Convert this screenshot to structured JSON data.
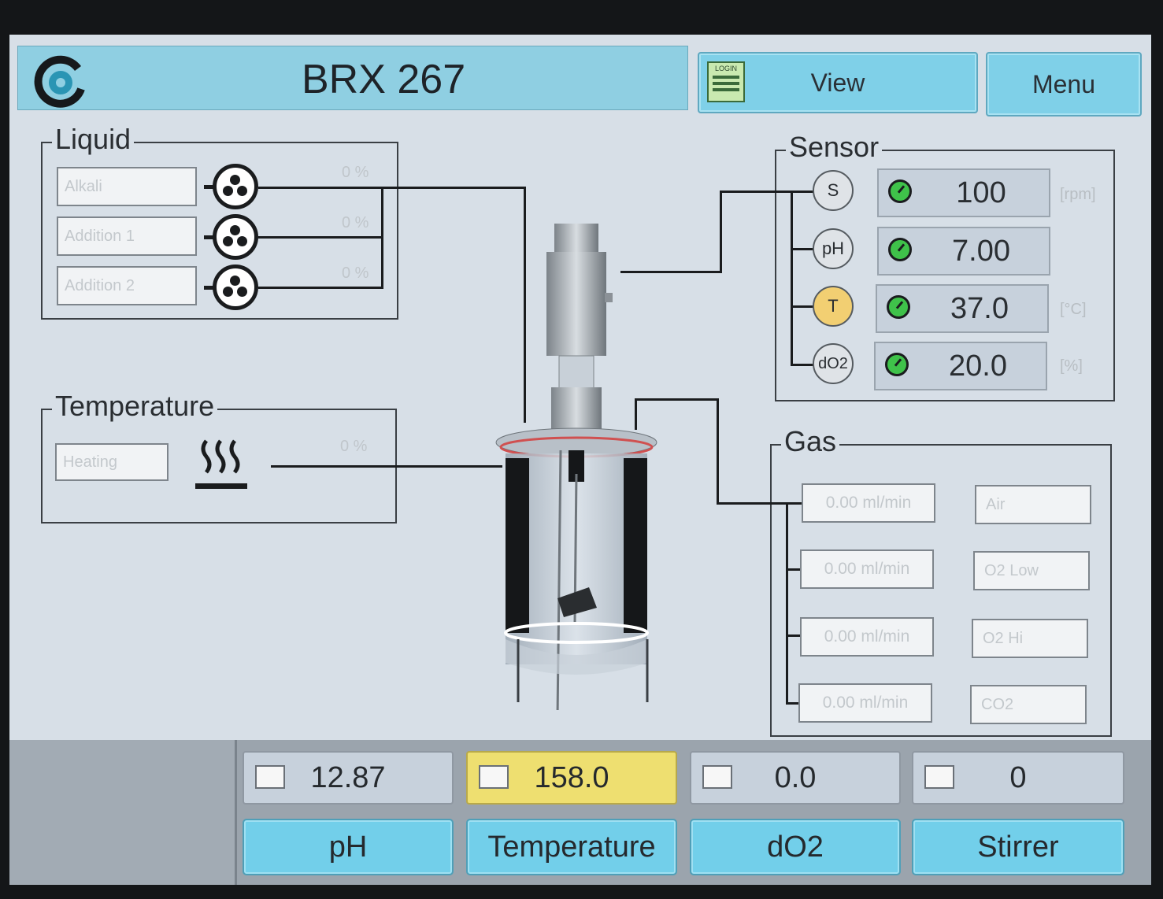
{
  "header": {
    "title": "BRX 267",
    "view_label": "View",
    "menu_label": "Menu",
    "login_icon_text": "LOGIN"
  },
  "liquid": {
    "label": "Liquid",
    "items": [
      {
        "name": "Alkali",
        "percent": "0 %"
      },
      {
        "name": "Addition 1",
        "percent": "0 %"
      },
      {
        "name": "Addition 2",
        "percent": "0 %"
      }
    ]
  },
  "temperature_panel": {
    "label": "Temperature",
    "mode": "Heating",
    "percent": "0 %"
  },
  "sensor": {
    "label": "Sensor",
    "rows": [
      {
        "symbol": "S",
        "value": "100",
        "unit": "[rpm]"
      },
      {
        "symbol": "pH",
        "value": "7.00",
        "unit": ""
      },
      {
        "symbol": "T",
        "value": "37.0",
        "unit": "[°C]"
      },
      {
        "symbol": "dO2",
        "value": "20.0",
        "unit": "[%]"
      }
    ]
  },
  "gas": {
    "label": "Gas",
    "rows": [
      {
        "flow": "0.00 ml/min",
        "name": "Air"
      },
      {
        "flow": "0.00 ml/min",
        "name": "O2 Low"
      },
      {
        "flow": "0.00 ml/min",
        "name": "O2 Hi"
      },
      {
        "flow": "0.00 ml/min",
        "name": "CO2"
      }
    ]
  },
  "bottom": {
    "cells": [
      {
        "value": "12.87",
        "label": "pH"
      },
      {
        "value": "158.0",
        "label": "Temperature"
      },
      {
        "value": "0.0",
        "label": "dO2"
      },
      {
        "value": "0",
        "label": "Stirrer"
      }
    ]
  },
  "colors": {
    "accent": "#7fd0e8",
    "screen": "#d7dfe7",
    "highlight": "#eedf70",
    "temp_bubble": "#f2cf72",
    "status_green": "#3fc24a"
  }
}
